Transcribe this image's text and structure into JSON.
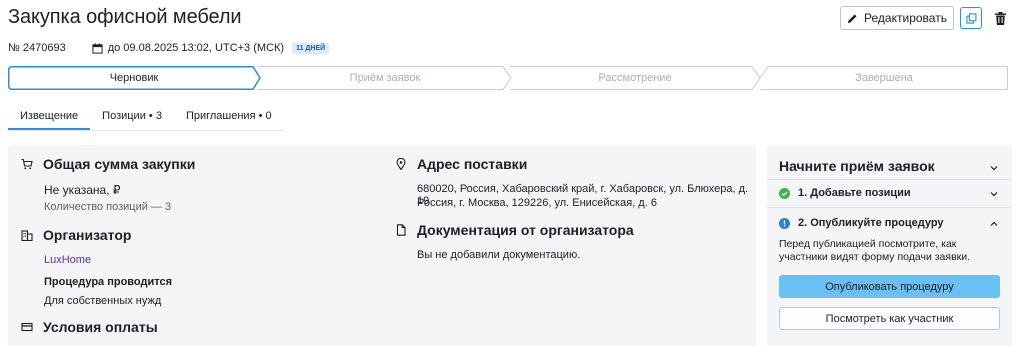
{
  "header": {
    "title": "Закупка офисной мебели",
    "edit_label": "Редактировать",
    "number": "№ 2470693",
    "deadline": "до 09.08.2025 13:02, UTC+3 (МСК)",
    "days_badge": "11 ДНЕЙ"
  },
  "stepper": {
    "steps": [
      {
        "label": "Черновик",
        "state": "active"
      },
      {
        "label": "Приём заявок",
        "state": "inactive"
      },
      {
        "label": "Рассмотрение",
        "state": "inactive"
      },
      {
        "label": "Завершена",
        "state": "inactive"
      }
    ],
    "active_color": "#2b8fdc",
    "inactive_color": "#c9ced4"
  },
  "tabs": [
    {
      "label": "Извещение",
      "active": true
    },
    {
      "label": "Позиции • 3",
      "active": false
    },
    {
      "label": "Приглашения • 0",
      "active": false
    }
  ],
  "summary": {
    "total_title": "Общая сумма закупки",
    "total_value": "Не указана, ₽",
    "positions_count": "Количество позиций — 3",
    "organizer_title": "Организатор",
    "organizer_name": "LuxHome",
    "procedure_label": "Процедура проводится",
    "procedure_value": "Для собственных нужд",
    "payment_title": "Условия оплаты",
    "address_title": "Адрес поставки",
    "address_lines": [
      "680020, Россия, Хабаровский край, г. Хабаровск, ул. Блюхера, д. 19",
      "Россия, г. Москва, 129226, ул. Енисейская, д. 6"
    ],
    "docs_title": "Документация от организатора",
    "docs_value": "Вы не добавили документацию."
  },
  "side": {
    "title": "Начните приём заявок",
    "step1": "1. Добавьте позиции",
    "step2": "2. Опубликуйте процедуру",
    "hint": "Перед публикацией посмотрите, как участники видят форму подачи заявки.",
    "publish_label": "Опубликовать процедуру",
    "view_label": "Посмотреть как участник"
  },
  "colors": {
    "accent": "#2b8fdc",
    "publish_button": "#69c0f5",
    "link": "#5a2ea6",
    "success": "#3bb54a",
    "info": "#2b7fd4",
    "panel_bg": "#f4f5f7"
  },
  "icons": [
    "pencil-icon",
    "copy-icon",
    "trash-icon",
    "calendar-icon",
    "cart-icon",
    "building-icon",
    "card-icon",
    "location-pin-icon",
    "document-icon",
    "chevron-down-icon",
    "chevron-up-icon",
    "check-circle-icon",
    "info-circle-icon"
  ]
}
